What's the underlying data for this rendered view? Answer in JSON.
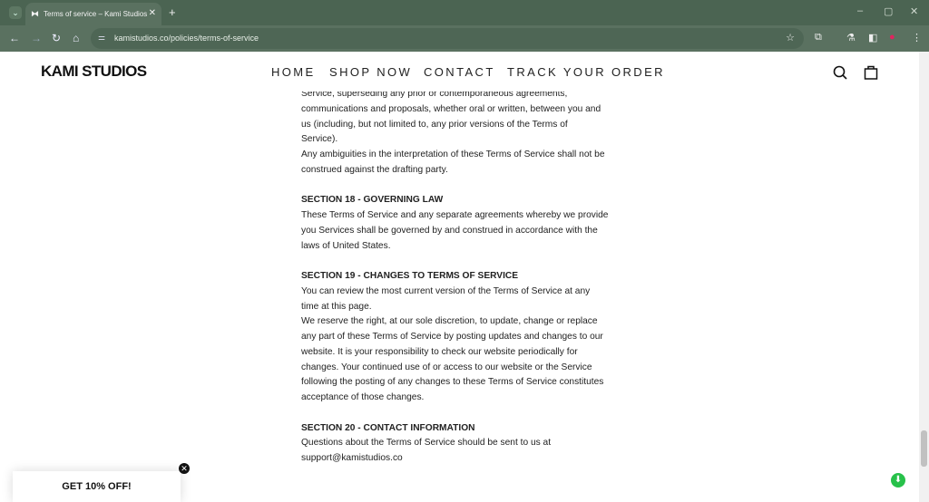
{
  "browser": {
    "tab_title": "Terms of service – Kami Studios",
    "url": "kamistudios.co/policies/terms-of-service"
  },
  "site": {
    "logo": "KAMI STUDIOS",
    "menu": [
      "HOME",
      "SHOP NOW",
      "CONTACT",
      "TRACK YOUR ORDER"
    ]
  },
  "content": {
    "intro_lines": [
      "Service, superseding any prior or contemporaneous agreements,",
      "communications and proposals, whether oral or written, between you and",
      "us (including, but not limited to, any prior versions of the Terms of",
      "Service).",
      "Any ambiguities in the interpretation of these Terms of Service shall not be",
      "construed against the drafting party."
    ],
    "sections": [
      {
        "heading": "SECTION 18 - GOVERNING LAW",
        "lines": [
          "These Terms of Service and any separate agreements whereby we provide",
          "you Services shall be governed by and construed in accordance with the",
          "laws of United States."
        ]
      },
      {
        "heading": "SECTION 19 - CHANGES TO TERMS OF SERVICE",
        "lines": [
          "You can review the most current version of the Terms of Service at any",
          "time at this page.",
          "We reserve the right, at our sole discretion, to update, change or replace",
          "any part of these Terms of Service by posting updates and changes to our",
          "website. It is your responsibility to check our website periodically for",
          "changes. Your continued use of or access to our website or the Service",
          "following the posting of any changes to these Terms of Service constitutes",
          "acceptance of those changes."
        ]
      },
      {
        "heading": "SECTION 20 - CONTACT INFORMATION",
        "lines": [
          "Questions about the Terms of Service should be sent to us at",
          "support@kamistudios.co"
        ]
      }
    ]
  },
  "promo": {
    "label": "GET 10% OFF!"
  },
  "colors": {
    "chrome": "#4b6452",
    "toolbar": "#5a7160",
    "promo_badge": "#27c14a"
  }
}
